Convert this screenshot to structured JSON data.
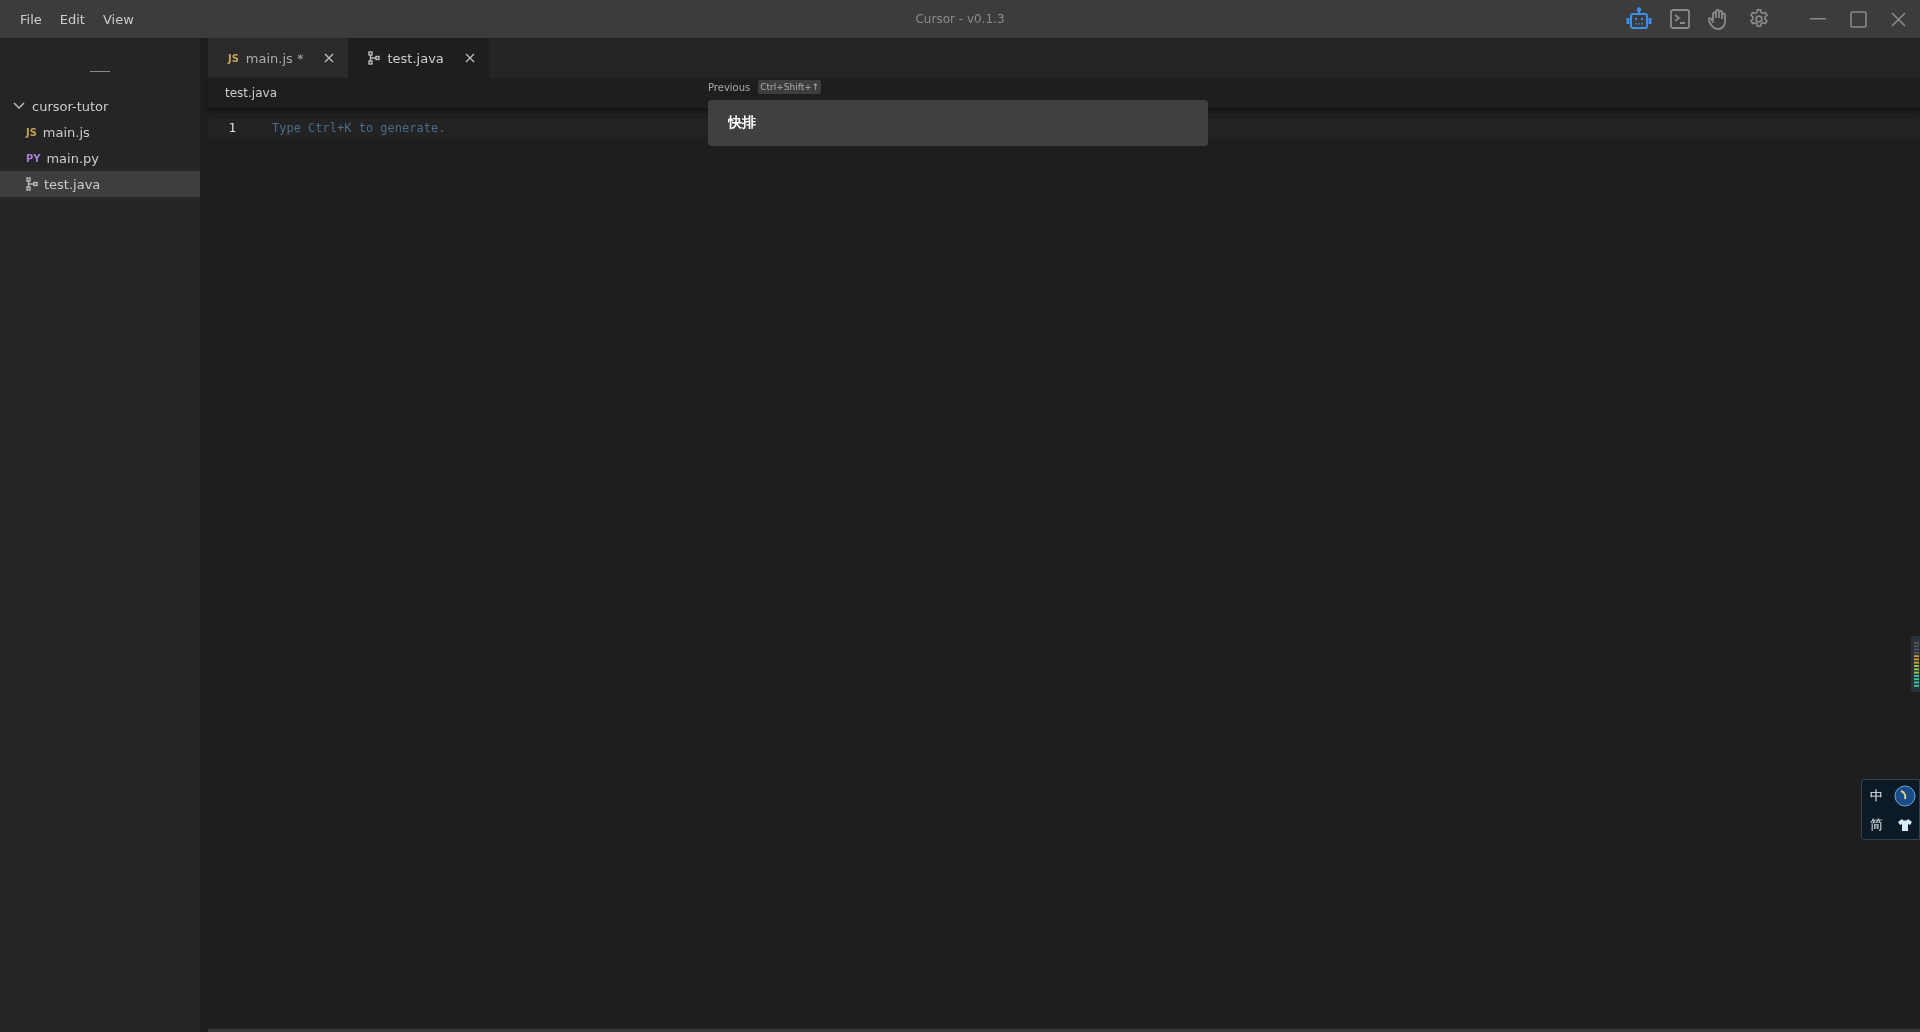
{
  "window": {
    "title": "Cursor - v0.1.3"
  },
  "menu": [
    "File",
    "Edit",
    "View"
  ],
  "toolbar": [
    {
      "kind": "robot",
      "selected": true
    },
    {
      "kind": "terminal",
      "selected": false
    },
    {
      "kind": "hand",
      "selected": false
    },
    {
      "kind": "gear",
      "selected": false
    }
  ],
  "sidebar": {
    "root": {
      "label": "cursor-tutor",
      "expanded": true,
      "children": [
        {
          "label": "main.js",
          "kind": "js",
          "badge": "JS",
          "selected": false
        },
        {
          "label": "main.py",
          "kind": "py",
          "badge": "PY",
          "selected": false
        },
        {
          "label": "test.java",
          "kind": "java",
          "selected": true
        }
      ]
    }
  },
  "tabs": [
    {
      "label": "main.js *",
      "kind": "js",
      "badge": "JS",
      "selected": false
    },
    {
      "label": "test.java",
      "kind": "java",
      "selected": true
    }
  ],
  "editor": {
    "breadcrumb": "test.java",
    "lines": [
      {
        "number": "1",
        "placeholder": "Type Ctrl+K to generate."
      }
    ]
  },
  "prompt": {
    "history_label": "Previous",
    "shortcut": "Ctrl+Shift+↑",
    "value": "快排"
  },
  "ime_toolbar": {
    "top": "中",
    "bottom": "简"
  }
}
